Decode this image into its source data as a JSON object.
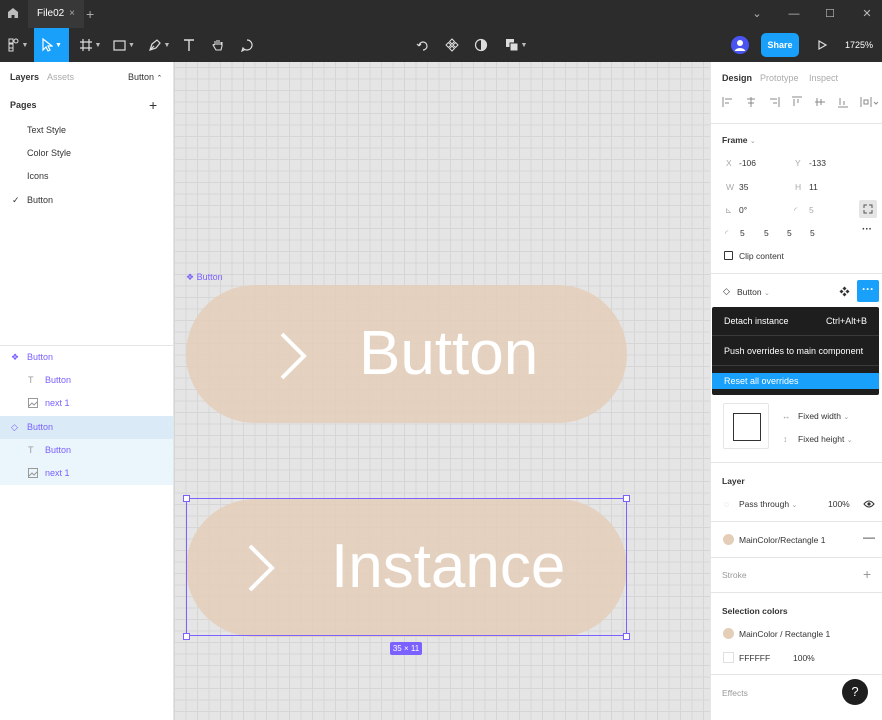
{
  "titlebar": {
    "tab_label": "File02",
    "close_glyph": "×",
    "new_tab_glyph": "+",
    "min_glyph": "—",
    "max_glyph": "☐",
    "close_win_glyph": "✕"
  },
  "toolbar": {
    "share_label": "Share",
    "zoom_label": "1725%",
    "accent_color": "#18a0fb"
  },
  "left_panel": {
    "tabs": [
      "Layers",
      "Assets"
    ],
    "page_selector": "Button",
    "pages_header": "Pages",
    "pages": [
      "Text Style",
      "Color Style",
      "Icons",
      "Button"
    ],
    "current_page": "Button",
    "layers": [
      {
        "icon": "component-icon",
        "label": "Button",
        "indent": 0
      },
      {
        "icon": "text-icon",
        "label": "Button",
        "indent": 1
      },
      {
        "icon": "image-icon",
        "label": "next 1",
        "indent": 1
      },
      {
        "icon": "instance-icon",
        "label": "Button",
        "indent": 0
      },
      {
        "icon": "text-icon",
        "label": "Button",
        "indent": 1
      },
      {
        "icon": "image-icon",
        "label": "next 1",
        "indent": 1
      }
    ]
  },
  "canvas": {
    "frame_label": "Button",
    "component_text": "Button",
    "instance_text": "Instance",
    "chevron": "›",
    "size_badge": "35 × 11",
    "shape_color": "#e5ceb8",
    "selection_color": "#7b61ff"
  },
  "right_panel": {
    "tabs": [
      "Design",
      "Prototype",
      "Inspect"
    ],
    "frame_header": "Frame",
    "x_label": "X",
    "x_value": "-106",
    "y_label": "Y",
    "y_value": "-133",
    "w_label": "W",
    "w_value": "35",
    "h_label": "H",
    "h_value": "11",
    "rotation": "0°",
    "corner_radius": "5",
    "corners": [
      "5",
      "5",
      "5",
      "5"
    ],
    "clip_content": "Clip content",
    "instance_name": "Button",
    "menu": {
      "detach": "Detach instance",
      "detach_shortcut": "Ctrl+Alt+B",
      "push": "Push overrides to main component",
      "reset": "Reset all overrides"
    },
    "fixed_width": "Fixed width",
    "fixed_height": "Fixed height",
    "layer_header": "Layer",
    "blend_mode": "Pass through",
    "opacity": "100%",
    "fill_name": "MainColor/Rectangle 1",
    "stroke_header": "Stroke",
    "selection_colors_header": "Selection colors",
    "sel_color_1": "MainColor / Rectangle 1",
    "sel_color_2_hex": "FFFFFF",
    "sel_color_2_opacity": "100%",
    "effects_header": "Effects",
    "help": "?"
  }
}
